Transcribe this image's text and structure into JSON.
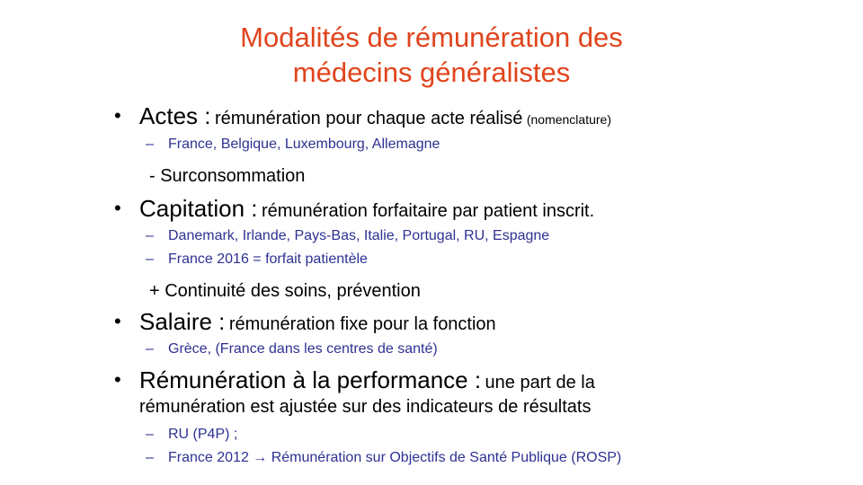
{
  "slide": {
    "title_line1": "Modalités de rémunération des",
    "title_line2": "médecins généralistes"
  },
  "items": [
    {
      "heading": "Actes :",
      "desc": "rémunération pour chaque acte réalisé",
      "note": "(nomenclature)",
      "sub": [
        "France, Belgique, Luxembourg, Allemagne"
      ],
      "extra": "- Surconsommation"
    },
    {
      "heading": "Capitation :",
      "desc": "rémunération forfaitaire par patient inscrit.",
      "sub": [
        "Danemark, Irlande, Pays-Bas, Italie, Portugal, RU, Espagne",
        "France 2016 = forfait patientèle"
      ],
      "extra": "+ Continuité des soins, prévention"
    },
    {
      "heading": "Salaire :",
      "desc": "rémunération fixe pour la fonction",
      "sub": [
        "Grèce, (France dans les centres de santé)"
      ]
    },
    {
      "heading": "Rémunération à la performance :",
      "desc": "une part de la",
      "desc2": "rémunération est  ajustée sur des indicateurs de résultats",
      "sub": [
        "RU (P4P) ;",
        "France 2012 → Rémunération sur Objectifs de Santé Publique (ROSP)"
      ]
    }
  ]
}
